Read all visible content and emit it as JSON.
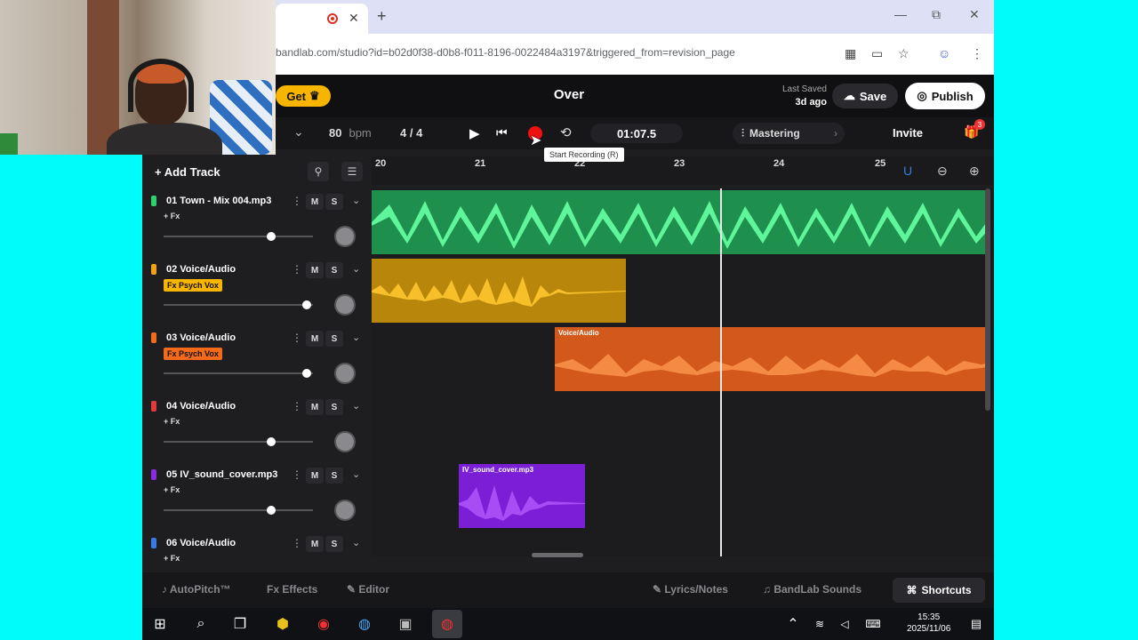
{
  "browser": {
    "url": "bandlab.com/studio?id=b02d0f38-d0b8-f011-8196-0022484a3197&triggered_from=revision_page",
    "tab_close": "✕",
    "new_tab": "+",
    "win_min": "—",
    "win_max": "⧉",
    "win_close": "✕"
  },
  "app": {
    "get_label": "Get",
    "title": "Over",
    "last_saved_label": "Last Saved",
    "last_saved_value": "3d ago",
    "save_label": "Save",
    "publish_label": "Publish",
    "bpm_value": "80",
    "bpm_unit": "bpm",
    "time_sig": "4 / 4",
    "time_display": "01:07.5",
    "tooltip": "Start Recording (R)",
    "mastering_label": "Mastering",
    "invite_label": "Invite",
    "gift_badge": "3",
    "add_track_label": "+ Add Track",
    "ruler": [
      "20",
      "21",
      "22",
      "23",
      "24",
      "25"
    ],
    "clip_labels": {
      "voice": "Voice/Audio",
      "iv": "IV_sound_cover.mp3"
    }
  },
  "tracks": [
    {
      "name": "01  Town - Mix 004.mp3",
      "fx": "+ Fx",
      "color": "#2ecf6e",
      "m": "M",
      "s": "S"
    },
    {
      "name": "02  Voice/Audio",
      "fx": "Fx  Psych Vox",
      "color": "#f2a21a",
      "m": "M",
      "s": "S"
    },
    {
      "name": "03  Voice/Audio",
      "fx": "Fx  Psych Vox",
      "color": "#f26a1a",
      "m": "M",
      "s": "S"
    },
    {
      "name": "04  Voice/Audio",
      "fx": "+ Fx",
      "color": "#e23a3a",
      "m": "M",
      "s": "S"
    },
    {
      "name": "05  IV_sound_cover.mp3",
      "fx": "+ Fx",
      "color": "#8a2be2",
      "m": "M",
      "s": "S"
    },
    {
      "name": "06  Voice/Audio",
      "fx": "+ Fx",
      "color": "#3a7ae2",
      "m": "M",
      "s": "S"
    }
  ],
  "bottom": {
    "autopitch": "AutoPitch™",
    "effects": "Effects",
    "editor": "Editor",
    "lyrics": "Lyrics/Notes",
    "sounds": "BandLab Sounds",
    "shortcuts": "Shortcuts"
  },
  "taskbar": {
    "time": "15:35",
    "date": "2025/11/06"
  },
  "colors": {
    "accent_yellow": "#f7b500",
    "record_red": "#e11111",
    "track1": "#2ecf6e",
    "track2": "#e8a21a",
    "track3": "#f26a1a",
    "track5": "#8a1ee2"
  }
}
